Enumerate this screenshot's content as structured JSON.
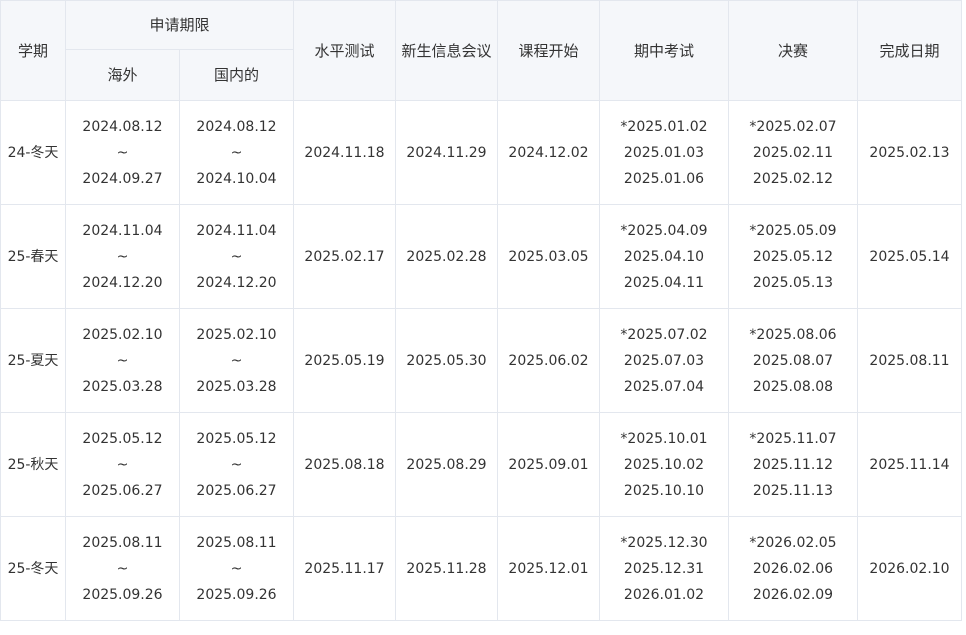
{
  "headers": {
    "term": "学期",
    "application_period": "申请期限",
    "overseas": "海外",
    "domestic": "国内的",
    "placement_test": "水平测试",
    "orientation": "新生信息会议",
    "course_start": "课程开始",
    "midterm": "期中考试",
    "final": "决赛",
    "completion": "完成日期"
  },
  "rows": [
    {
      "term": "24-冬天",
      "overseas": [
        "2024.08.12",
        "~",
        "2024.09.27"
      ],
      "domestic": [
        "2024.08.12",
        "~",
        "2024.10.04"
      ],
      "placement_test": "2024.11.18",
      "orientation": "2024.11.29",
      "course_start": "2024.12.02",
      "midterm": [
        "*2025.01.02",
        "2025.01.03",
        "2025.01.06"
      ],
      "final": [
        "*2025.02.07",
        "2025.02.11",
        "2025.02.12"
      ],
      "completion": "2025.02.13"
    },
    {
      "term": "25-春天",
      "overseas": [
        "2024.11.04",
        "~",
        "2024.12.20"
      ],
      "domestic": [
        "2024.11.04",
        "~",
        "2024.12.20"
      ],
      "placement_test": "2025.02.17",
      "orientation": "2025.02.28",
      "course_start": "2025.03.05",
      "midterm": [
        "*2025.04.09",
        "2025.04.10",
        "2025.04.11"
      ],
      "final": [
        "*2025.05.09",
        "2025.05.12",
        "2025.05.13"
      ],
      "completion": "2025.05.14"
    },
    {
      "term": "25-夏天",
      "overseas": [
        "2025.02.10",
        "~",
        "2025.03.28"
      ],
      "domestic": [
        "2025.02.10",
        "~",
        "2025.03.28"
      ],
      "placement_test": "2025.05.19",
      "orientation": "2025.05.30",
      "course_start": "2025.06.02",
      "midterm": [
        "*2025.07.02",
        "2025.07.03",
        "2025.07.04"
      ],
      "final": [
        "*2025.08.06",
        "2025.08.07",
        "2025.08.08"
      ],
      "completion": "2025.08.11"
    },
    {
      "term": "25-秋天",
      "overseas": [
        "2025.05.12",
        "~",
        "2025.06.27"
      ],
      "domestic": [
        "2025.05.12",
        "~",
        "2025.06.27"
      ],
      "placement_test": "2025.08.18",
      "orientation": "2025.08.29",
      "course_start": "2025.09.01",
      "midterm": [
        "*2025.10.01",
        "2025.10.02",
        "2025.10.10"
      ],
      "final": [
        "*2025.11.07",
        "2025.11.12",
        "2025.11.13"
      ],
      "completion": "2025.11.14"
    },
    {
      "term": "25-冬天",
      "overseas": [
        "2025.08.11",
        "~",
        "2025.09.26"
      ],
      "domestic": [
        "2025.08.11",
        "~",
        "2025.09.26"
      ],
      "placement_test": "2025.11.17",
      "orientation": "2025.11.28",
      "course_start": "2025.12.01",
      "midterm": [
        "*2025.12.30",
        "2025.12.31",
        "2026.01.02"
      ],
      "final": [
        "*2026.02.05",
        "2026.02.06",
        "2026.02.09"
      ],
      "completion": "2026.02.10"
    }
  ]
}
